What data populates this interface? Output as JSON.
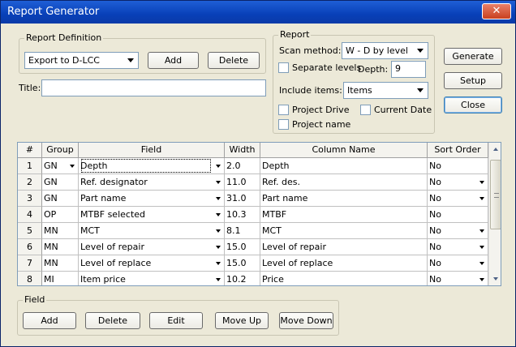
{
  "window": {
    "title": "Report Generator"
  },
  "report_definition": {
    "group_label": "Report Definition",
    "selected": "Export to D-LCC",
    "add_label": "Add",
    "delete_label": "Delete"
  },
  "title_field": {
    "label": "Title:",
    "value": ""
  },
  "report": {
    "group_label": "Report",
    "scan_method_label": "Scan method:",
    "scan_method_value": "W - D by level",
    "separate_levels_label": "Separate levels",
    "depth_label": "Depth:",
    "depth_value": "9",
    "include_items_label": "Include items:",
    "include_items_value": "Items",
    "project_drive_label": "Project Drive",
    "current_date_label": "Current Date",
    "project_name_label": "Project name"
  },
  "side_buttons": {
    "generate": "Generate",
    "setup": "Setup",
    "close": "Close"
  },
  "grid": {
    "headers": [
      "#",
      "Group",
      "Field",
      "Width",
      "Column Name",
      "Sort Order"
    ],
    "rows": [
      {
        "num": "1",
        "group": "GN",
        "field": "Depth",
        "width": "2.0",
        "column": "Depth",
        "sort": "No"
      },
      {
        "num": "2",
        "group": "GN",
        "field": "Ref. designator",
        "width": "11.0",
        "column": "Ref. des.",
        "sort": "No"
      },
      {
        "num": "3",
        "group": "GN",
        "field": "Part name",
        "width": "31.0",
        "column": "Part name",
        "sort": "No"
      },
      {
        "num": "4",
        "group": "OP",
        "field": "MTBF selected",
        "width": "10.3",
        "column": "MTBF",
        "sort": "No"
      },
      {
        "num": "5",
        "group": "MN",
        "field": "MCT",
        "width": "8.1",
        "column": "MCT",
        "sort": "No"
      },
      {
        "num": "6",
        "group": "MN",
        "field": "Level of repair",
        "width": "15.0",
        "column": "Level of repair",
        "sort": "No"
      },
      {
        "num": "7",
        "group": "MN",
        "field": "Level of replace",
        "width": "15.0",
        "column": "Level of replace",
        "sort": "No"
      },
      {
        "num": "8",
        "group": "MI",
        "field": "Item price",
        "width": "10.2",
        "column": "Price",
        "sort": "No"
      }
    ]
  },
  "field_group": {
    "group_label": "Field",
    "add": "Add",
    "delete": "Delete",
    "edit": "Edit",
    "move_up": "Move Up",
    "move_down": "Move Down"
  },
  "colors": {
    "titlebar": "#0a46c8",
    "close_button": "#d0502a",
    "dialog_bg": "#ece9d8"
  }
}
